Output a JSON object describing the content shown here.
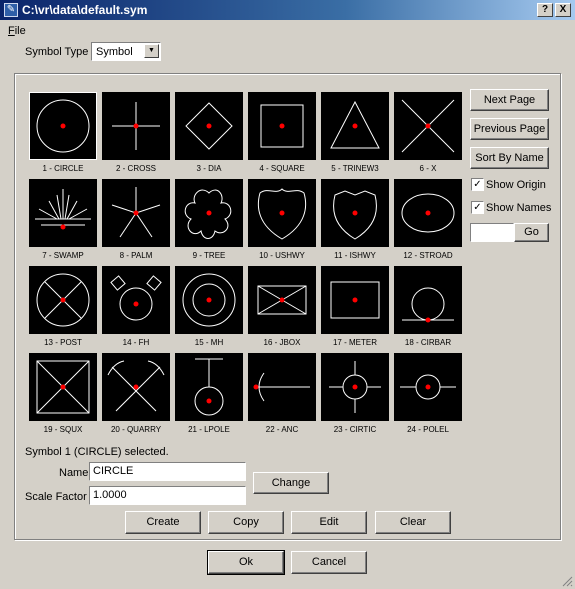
{
  "window": {
    "title": "C:\\vr\\data\\default.sym",
    "help_label": "?",
    "close_label": "X"
  },
  "menu": {
    "file_first": "F",
    "file_rest": "ile"
  },
  "symbol_type": {
    "label": "Symbol Type",
    "value": "Symbol"
  },
  "symbols": [
    {
      "label": "1 - CIRCLE"
    },
    {
      "label": "2 - CROSS"
    },
    {
      "label": "3 - DIA"
    },
    {
      "label": "4 - SQUARE"
    },
    {
      "label": "5 - TRINEW3"
    },
    {
      "label": "6 - X"
    },
    {
      "label": "7 - SWAMP"
    },
    {
      "label": "8 - PALM"
    },
    {
      "label": "9 - TREE"
    },
    {
      "label": "10 - USHWY"
    },
    {
      "label": "11 - ISHWY"
    },
    {
      "label": "12 - STROAD"
    },
    {
      "label": "13 - POST"
    },
    {
      "label": "14 - FH"
    },
    {
      "label": "15 - MH"
    },
    {
      "label": "16 - JBOX"
    },
    {
      "label": "17 - METER"
    },
    {
      "label": "18 - CIRBAR"
    },
    {
      "label": "19 - SQUX"
    },
    {
      "label": "20 - QUARRY"
    },
    {
      "label": "21 - LPOLE"
    },
    {
      "label": "22 - ANC"
    },
    {
      "label": "23 - CIRTIC"
    },
    {
      "label": "24 - POLEL"
    }
  ],
  "side": {
    "next_page": "Next Page",
    "previous_page": "Previous Page",
    "sort_by_name": "Sort By Name",
    "show_origin": "Show Origin",
    "show_names": "Show Names",
    "show_origin_checked": true,
    "show_names_checked": true,
    "goto_value": "",
    "go": "Go"
  },
  "status": "Symbol 1 (CIRCLE) selected.",
  "form": {
    "name_label": "Name",
    "name_value": "CIRCLE",
    "scale_label": "Scale Factor",
    "scale_value": "1.0000",
    "change": "Change"
  },
  "actions": {
    "create": "Create",
    "copy": "Copy",
    "edit": "Edit",
    "clear": "Clear"
  },
  "footer": {
    "ok": "Ok",
    "cancel": "Cancel"
  },
  "colors": {
    "origin_dot": "#ff0000",
    "symbol_stroke": "#ffffff",
    "symbol_bg": "#000000"
  }
}
